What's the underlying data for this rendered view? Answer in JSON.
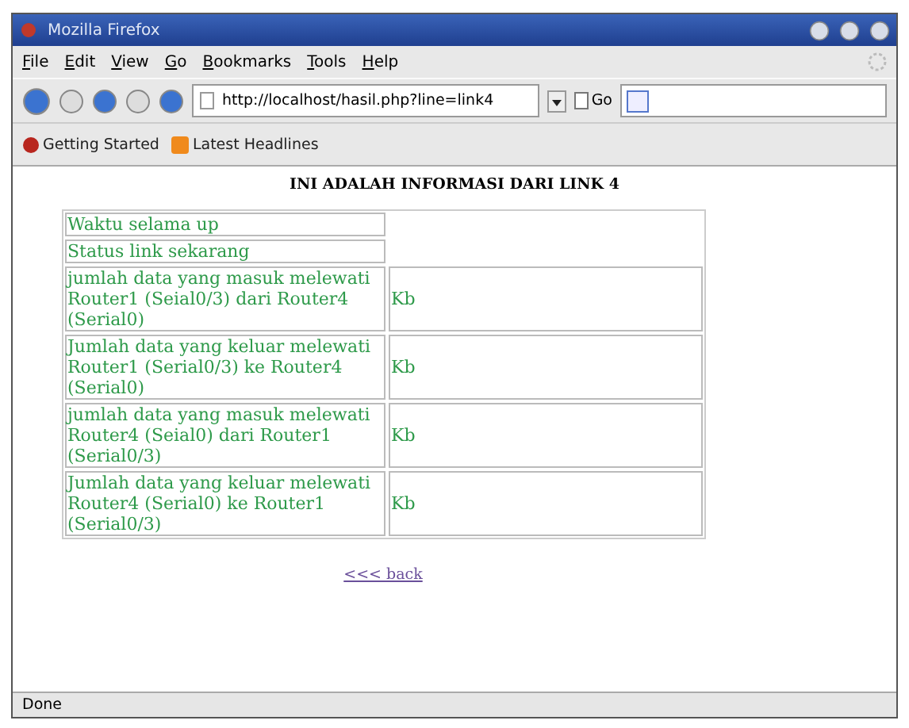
{
  "window": {
    "title": "Mozilla Firefox"
  },
  "menu": [
    "File",
    "Edit",
    "View",
    "Go",
    "Bookmarks",
    "Tools",
    "Help"
  ],
  "navigation": {
    "url": "http://localhost/hasil.php?line=link4",
    "go_label": "Go"
  },
  "bookmarks": [
    "Getting Started",
    "Latest Headlines"
  ],
  "page": {
    "heading": "INI ADALAH INFORMASI DARI LINK 4",
    "rows": [
      {
        "label": "Waktu selama up"
      },
      {
        "label": "Status link sekarang"
      },
      {
        "label": "jumlah data yang masuk melewati Router1 (Seial0/3) dari Router4 (Serial0)",
        "value": "Kb"
      },
      {
        "label": "Jumlah data yang keluar melewati Router1 (Serial0/3) ke Router4 (Serial0)",
        "value": "Kb"
      },
      {
        "label": "jumlah data yang masuk melewati Router4 (Seial0) dari Router1 (Serial0/3)",
        "value": "Kb"
      },
      {
        "label": "Jumlah data yang keluar melewati Router4 (Serial0) ke Router1 (Serial0/3)",
        "value": "Kb"
      }
    ],
    "back_link": "<<< back"
  },
  "status_bar": "Done"
}
